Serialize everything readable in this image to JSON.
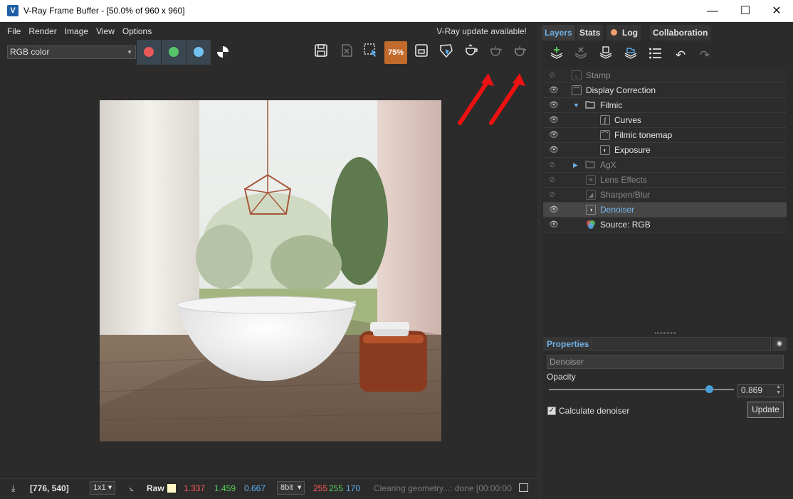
{
  "window": {
    "title": "V-Ray Frame Buffer - [50.0% of 960 x 960]",
    "minimize": "—",
    "maximize": "☐",
    "close": "✕"
  },
  "menu": [
    "File",
    "Render",
    "Image",
    "View",
    "Options"
  ],
  "update_notice": "V-Ray update available!",
  "toolbar": {
    "channel": "RGB color",
    "zoom_label": "75%"
  },
  "colors": {
    "red_channel": "#e85a5a",
    "green_channel": "#58c46a",
    "blue_channel": "#6fc3ee",
    "accent": "#6fb0e6",
    "zoom_button": "#c26a2b"
  },
  "status": {
    "coords": "[776, 540]",
    "sample": "1x1",
    "mode": "Raw",
    "r": "1.337",
    "g": "1.459",
    "b": "0.667",
    "bitdepth": "8bit",
    "r8": "255",
    "g8": "255",
    "b8": "170",
    "message": "Clearing geometry...: done [00:00:00"
  },
  "tabs": [
    "Layers",
    "Stats",
    "Log",
    "Collaboration"
  ],
  "layers": [
    {
      "label": "Stamp",
      "icon": "stamp-icon"
    },
    {
      "label": "Display Correction",
      "icon": "curve-icon"
    },
    {
      "label": "Filmic",
      "icon": "folder-icon"
    },
    {
      "label": "Curves",
      "icon": "curves-icon"
    },
    {
      "label": "Filmic tonemap",
      "icon": "tonemap-icon"
    },
    {
      "label": "Exposure",
      "icon": "exposure-icon"
    },
    {
      "label": "AgX",
      "icon": "folder-icon"
    },
    {
      "label": "Lens Effects",
      "icon": "lens-icon"
    },
    {
      "label": "Sharpen/Blur",
      "icon": "sharpen-icon"
    },
    {
      "label": "Denoiser",
      "icon": "denoiser-icon"
    },
    {
      "label": "Source: RGB",
      "icon": "source-icon"
    }
  ],
  "properties": {
    "title": "Properties",
    "layer_name": "Denoiser",
    "opacity_label": "Opacity",
    "opacity_value": "0.869",
    "opacity_fraction": 0.869,
    "checkbox_label": "Calculate denoiser",
    "update_button": "Update"
  }
}
